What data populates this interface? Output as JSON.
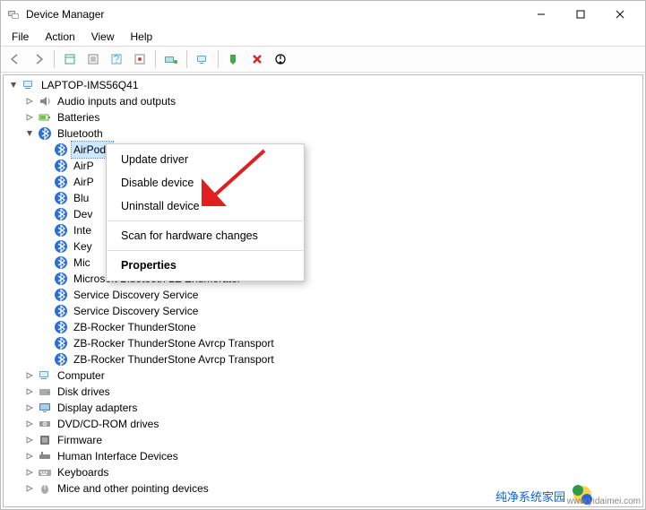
{
  "title": "Device Manager",
  "menus": {
    "file": "File",
    "action": "Action",
    "view": "View",
    "help": "Help"
  },
  "root": "LAPTOP-IMS56Q41",
  "categories": {
    "audio": "Audio inputs and outputs",
    "batteries": "Batteries",
    "bluetooth": "Bluetooth",
    "computer": "Computer",
    "disk": "Disk drives",
    "display": "Display adapters",
    "dvd": "DVD/CD-ROM drives",
    "firmware": "Firmware",
    "hid": "Human Interface Devices",
    "keyboards": "Keyboards",
    "mice": "Mice and other pointing devices"
  },
  "bt": {
    "0": "AirPods",
    "1": "AirP",
    "2": "AirP",
    "3": "Blu",
    "4": "Dev",
    "5": "Inte",
    "6": "Key",
    "7": "Mic",
    "8": "Microsoft Bluetooth LE Enumerator",
    "9": "Service Discovery Service",
    "10": "Service Discovery Service",
    "11": "ZB-Rocker ThunderStone",
    "12": "ZB-Rocker ThunderStone Avrcp Transport",
    "13": "ZB-Rocker ThunderStone Avrcp Transport"
  },
  "ctx": {
    "update": "Update driver",
    "disable": "Disable device",
    "uninstall": "Uninstall device",
    "scan": "Scan for hardware changes",
    "props": "Properties"
  },
  "wm": {
    "text": "纯净系统家园",
    "url": "www.yidaimei.com"
  }
}
